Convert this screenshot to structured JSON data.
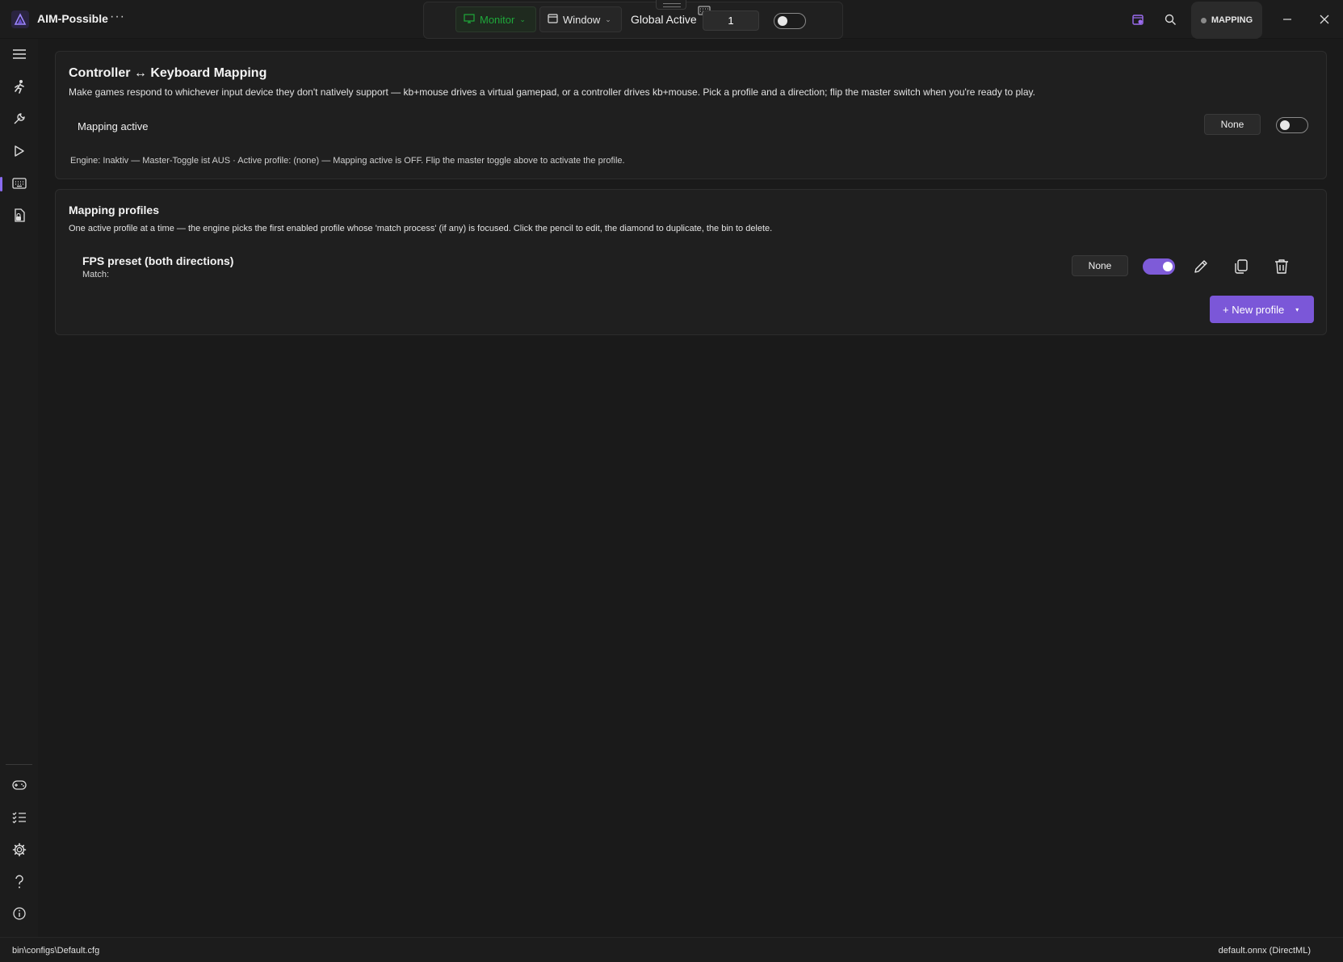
{
  "app": {
    "title": "AIM-Possible",
    "more_label": "···"
  },
  "toolbar": {
    "monitor_label": "Monitor",
    "window_label": "Window",
    "global_active_label": "Global Active",
    "global_active_value": "1",
    "global_active_on": false,
    "mode_badge": "MAPPING"
  },
  "mapping_card": {
    "title": "Controller ↔ Keyboard Mapping",
    "description": "Make games respond to whichever input device they don't natively support — kb+mouse drives a virtual gamepad, or a controller drives kb+mouse. Pick a profile and a direction; flip the master switch when you're ready to play.",
    "active_label": "Mapping active",
    "hotkey_button": "None",
    "active_on": false,
    "engine_status": "Engine: Inaktiv — Master-Toggle ist AUS · Active profile: (none)  —  Mapping active is OFF. Flip the master toggle above to activate the profile."
  },
  "profiles_card": {
    "title": "Mapping profiles",
    "description": "One active profile at a time — the engine picks the first enabled profile whose 'match process' (if any) is focused. Click the pencil to edit, the diamond to duplicate, the bin to delete.",
    "profiles": [
      {
        "name": "FPS preset (both directions)",
        "match": "Match:",
        "hotkey_button": "None",
        "enabled": true
      }
    ],
    "new_profile_button": "+ New profile",
    "new_profile_caret": "▾"
  },
  "sidebar": {
    "top_items": [
      "menu-icon",
      "running-figure-icon",
      "wrench-icon",
      "play-icon",
      "keyboard-icon",
      "document-lock-icon"
    ],
    "bottom_items": [
      "gamepad-icon",
      "checklist-icon",
      "gear-icon",
      "question-icon",
      "info-icon"
    ],
    "active_item": "keyboard-icon"
  },
  "statusbar": {
    "config_path": "bin\\configs\\Default.cfg",
    "model": "default.onnx (DirectML)"
  },
  "colors": {
    "accent": "#7b57d8",
    "monitor_green": "#1fa83a",
    "background": "#1a1a1a",
    "card": "#1f1f1f"
  }
}
